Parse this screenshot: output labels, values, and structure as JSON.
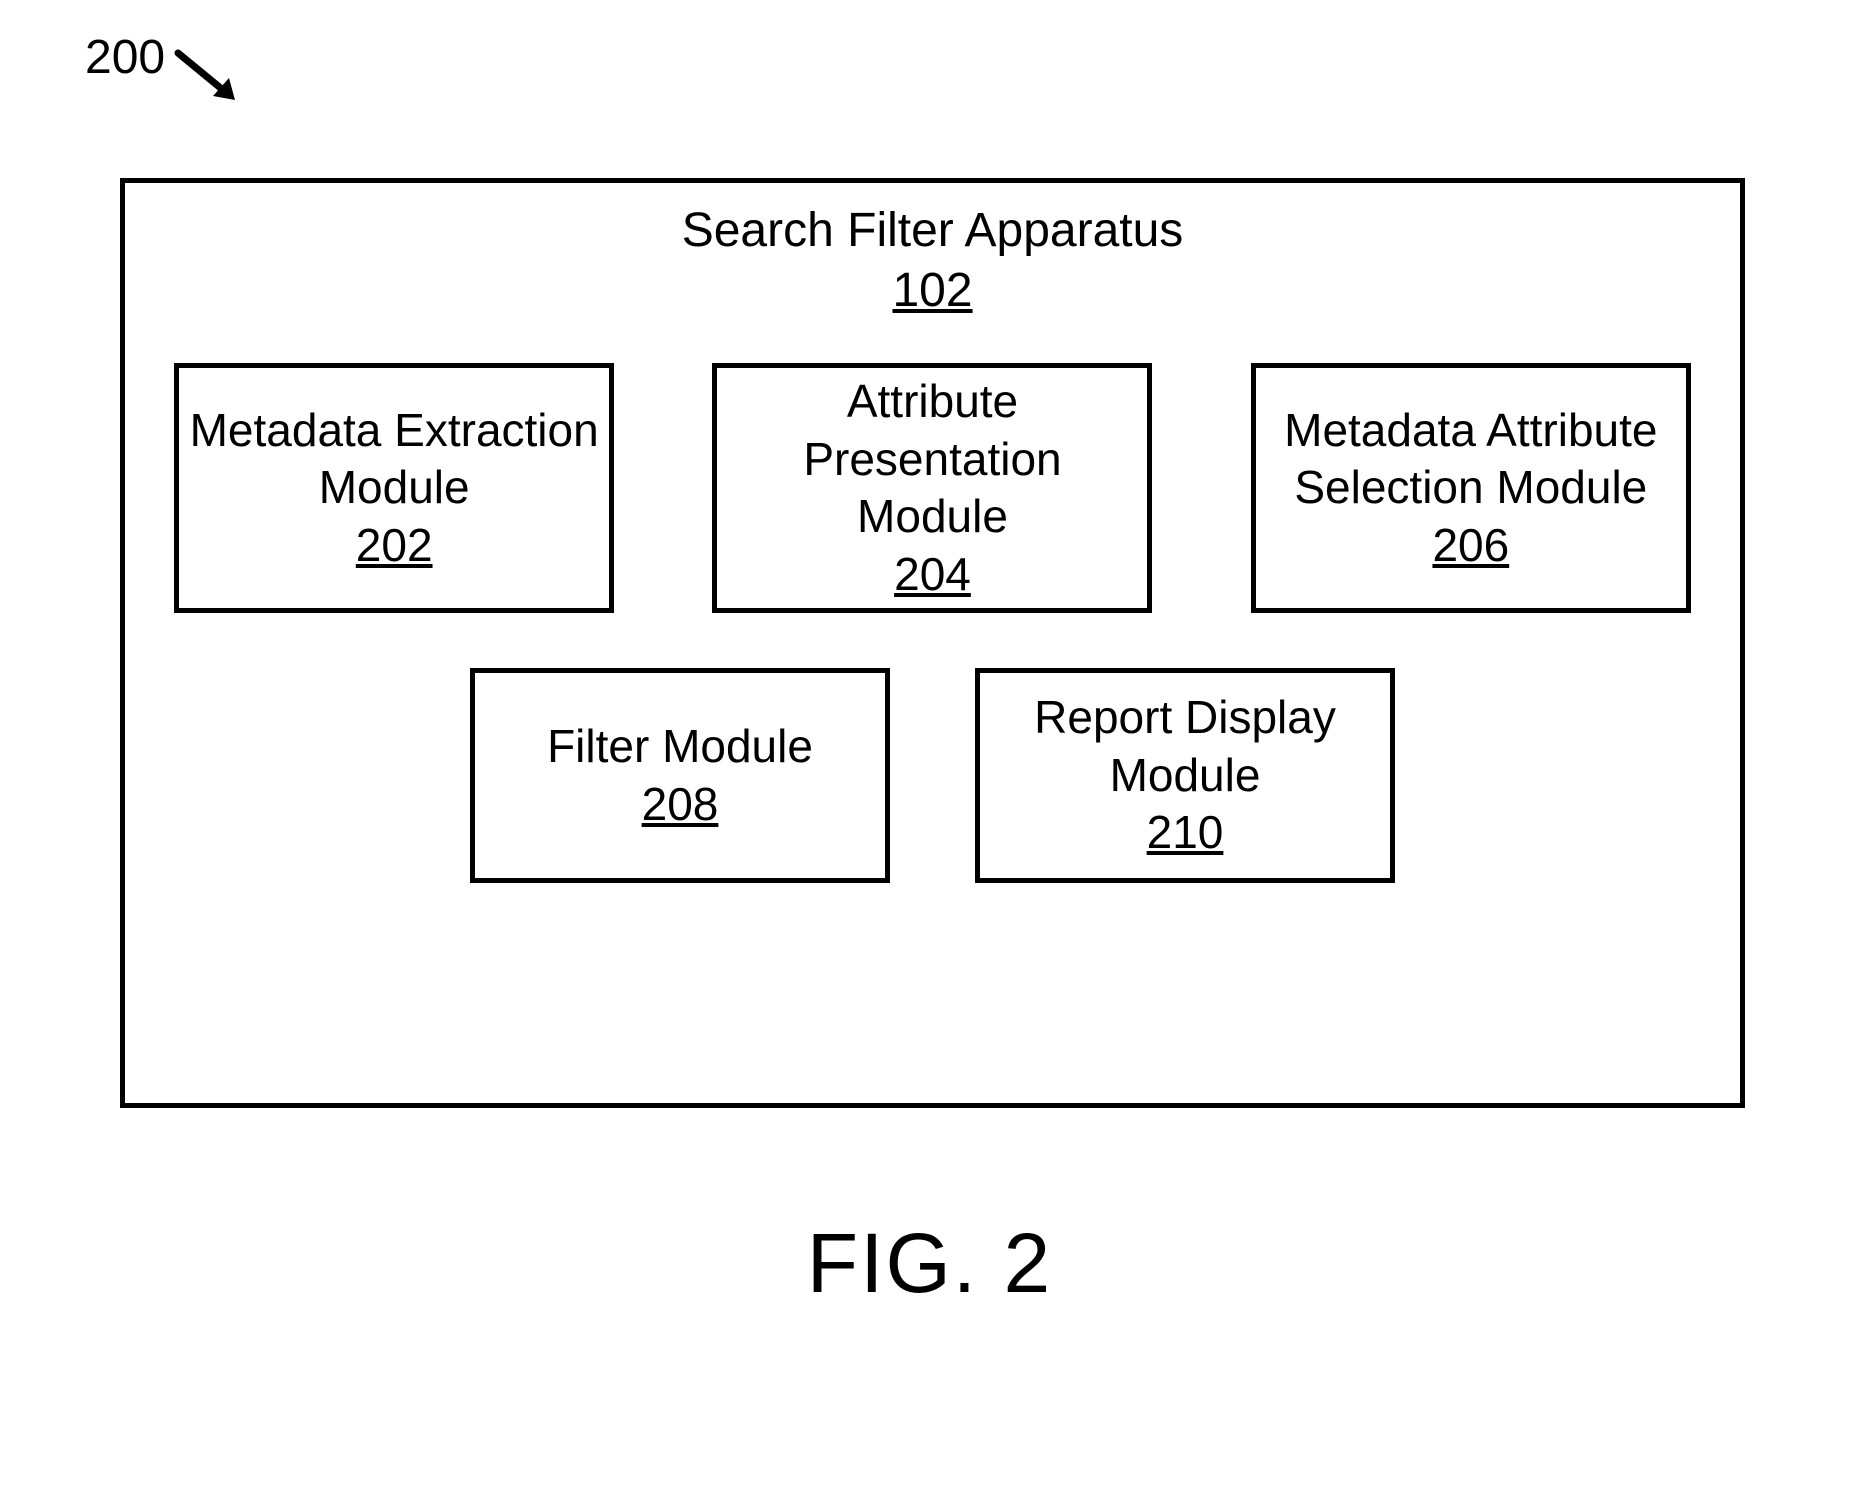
{
  "figure": {
    "ref_label": "200",
    "caption": "FIG. 2",
    "container": {
      "title": "Search Filter Apparatus",
      "ref": "102"
    },
    "modules_row1": [
      {
        "title": "Metadata Extraction Module",
        "ref": "202"
      },
      {
        "title": "Attribute Presentation Module",
        "ref": "204"
      },
      {
        "title": "Metadata Attribute Selection Module",
        "ref": "206"
      }
    ],
    "modules_row2": [
      {
        "title": "Filter Module",
        "ref": "208"
      },
      {
        "title": "Report Display Module",
        "ref": "210"
      }
    ]
  }
}
